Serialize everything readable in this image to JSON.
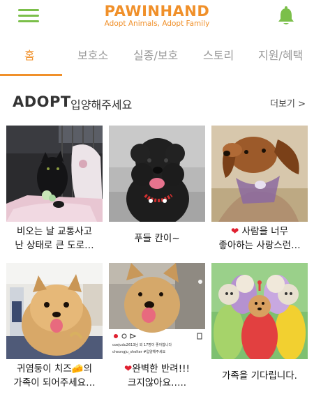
{
  "app": {
    "logo_title": "PAWINHAND",
    "logo_subtitle": "Adopt Animals, Adopt Family"
  },
  "colors": {
    "brand_orange": "#f0902a",
    "menu_green": "#7bbf4a",
    "tab_inactive": "#9a9a9a"
  },
  "tabs": [
    {
      "label": "홈",
      "active": true
    },
    {
      "label": "보호소",
      "active": false
    },
    {
      "label": "실종/보호",
      "active": false
    },
    {
      "label": "스토리",
      "active": false
    },
    {
      "label": "지원/혜택",
      "active": false
    }
  ],
  "section": {
    "title": "ADOPT",
    "subtitle": "입양해주세요",
    "more_label": "더보기 >"
  },
  "cards": [
    {
      "line1": "비오는 날 교통사고",
      "line2": "난 상태로 큰 도로…"
    },
    {
      "line1": "푸들 칸이~",
      "line2": ""
    },
    {
      "line1_prefix": "❤",
      "line1": " 사람을 너무",
      "line2": "좋아하는 사랑스런…"
    },
    {
      "line1": "귀염둥이 치즈🧀의",
      "line2": "가족이 되어주세요…"
    },
    {
      "line1_prefix": "❤",
      "line1": "완벽한 반려!!!",
      "line2": "크지않아요….."
    },
    {
      "line1": "가족을 기다립니다.",
      "line2": ""
    }
  ],
  "insta_overlay": {
    "account": "cheongju_shelter",
    "caption": "coejudu2613님 외 17명이 좋아합니다",
    "tag": "#입양해주세요"
  },
  "icons": {
    "menu": "hamburger-icon",
    "bell": "bell-icon",
    "heart": "heart-icon",
    "cheese": "cheese-emoji"
  }
}
